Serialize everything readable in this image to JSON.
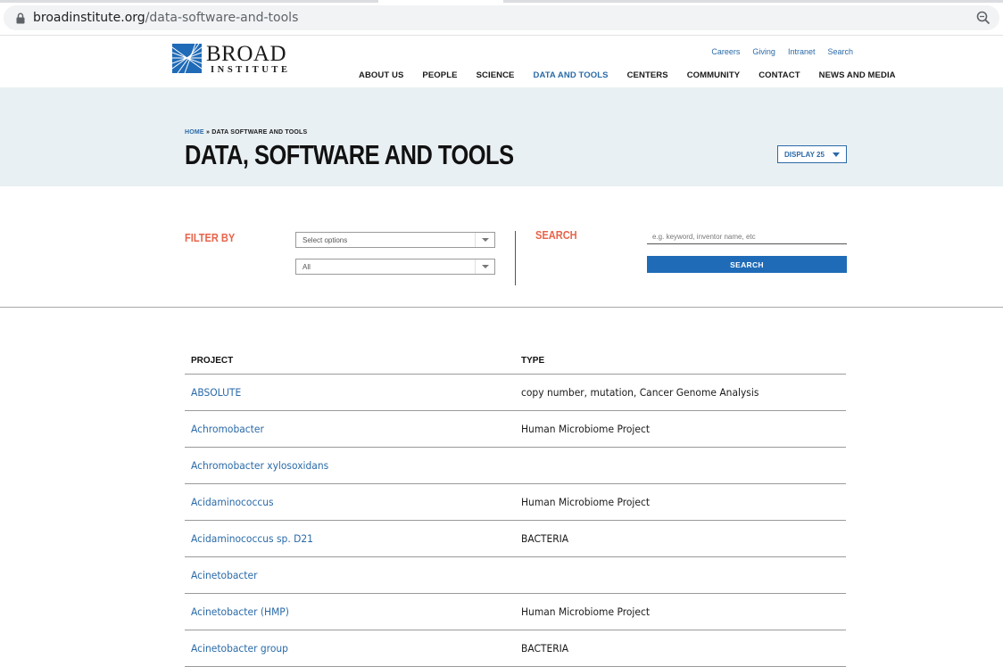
{
  "browser": {
    "url_domain": "broadinstitute.org",
    "url_path": "/data-software-and-tools"
  },
  "header": {
    "logo_word": "BROAD",
    "logo_sub": "INSTITUTE",
    "utility_links": [
      "Careers",
      "Giving",
      "Intranet",
      "Search"
    ],
    "nav": [
      "ABOUT US",
      "PEOPLE",
      "SCIENCE",
      "DATA AND TOOLS",
      "CENTERS",
      "COMMUNITY",
      "CONTACT",
      "NEWS AND MEDIA"
    ],
    "active_nav": "DATA AND TOOLS"
  },
  "hero": {
    "crumb_home": "HOME",
    "crumb_sep": " » ",
    "crumb_current": "DATA SOFTWARE AND TOOLS",
    "title": "DATA, SOFTWARE AND TOOLS",
    "display_label": "DISPLAY 25"
  },
  "filters": {
    "filter_label": "FILTER BY",
    "select1_value": "Select options",
    "select2_value": "All",
    "search_label": "SEARCH",
    "search_placeholder": "e.g. keyword, inventor name, etc",
    "search_button": "SEARCH"
  },
  "table": {
    "headers": [
      "PROJECT",
      "TYPE"
    ],
    "rows": [
      {
        "project": "ABSOLUTE",
        "type": "copy number, mutation, Cancer Genome Analysis"
      },
      {
        "project": "Achromobacter",
        "type": "Human Microbiome Project"
      },
      {
        "project": "Achromobacter xylosoxidans",
        "type": ""
      },
      {
        "project": "Acidaminococcus",
        "type": "Human Microbiome Project"
      },
      {
        "project": "Acidaminococcus sp. D21",
        "type": "BACTERIA"
      },
      {
        "project": "Acinetobacter",
        "type": ""
      },
      {
        "project": "Acinetobacter (HMP)",
        "type": "Human Microbiome Project"
      },
      {
        "project": "Acinetobacter group",
        "type": "BACTERIA"
      }
    ]
  },
  "colors": {
    "link_blue": "#2a6aa8",
    "accent_orange": "#e8644a",
    "hero_bg": "#e9f0f3",
    "button_blue": "#1f6bb8"
  }
}
